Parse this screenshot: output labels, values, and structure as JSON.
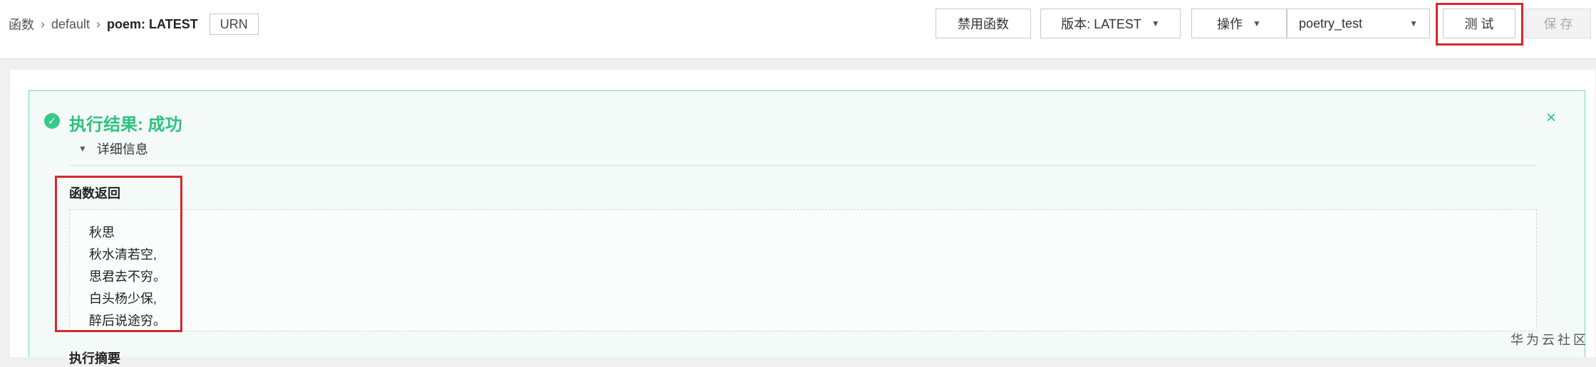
{
  "breadcrumb": {
    "root": "函数",
    "group": "default",
    "current": "poem: LATEST",
    "sep": "›",
    "urn_label": "URN"
  },
  "toolbar": {
    "disable_label": "禁用函数",
    "version_label": "版本: LATEST",
    "actions_label": "操作",
    "test_event_value": "poetry_test",
    "test_label": "测 试",
    "save_label": "保 存",
    "caret": "▼"
  },
  "result": {
    "check": "✓",
    "status_text": "执行结果: 成功",
    "close": "×",
    "details_label": "详细信息",
    "details_caret": "▼",
    "return_title": "函数返回",
    "return_lines": [
      "秋思",
      "秋水清若空,",
      "思君去不穷。",
      "白头杨少保,",
      "醉后说途穷。"
    ],
    "summary_title": "执行摘要"
  },
  "watermark": "华为云社区",
  "colors": {
    "success": "#2ec27e",
    "highlight": "#d9262c",
    "result_border": "#7bd8b5"
  }
}
